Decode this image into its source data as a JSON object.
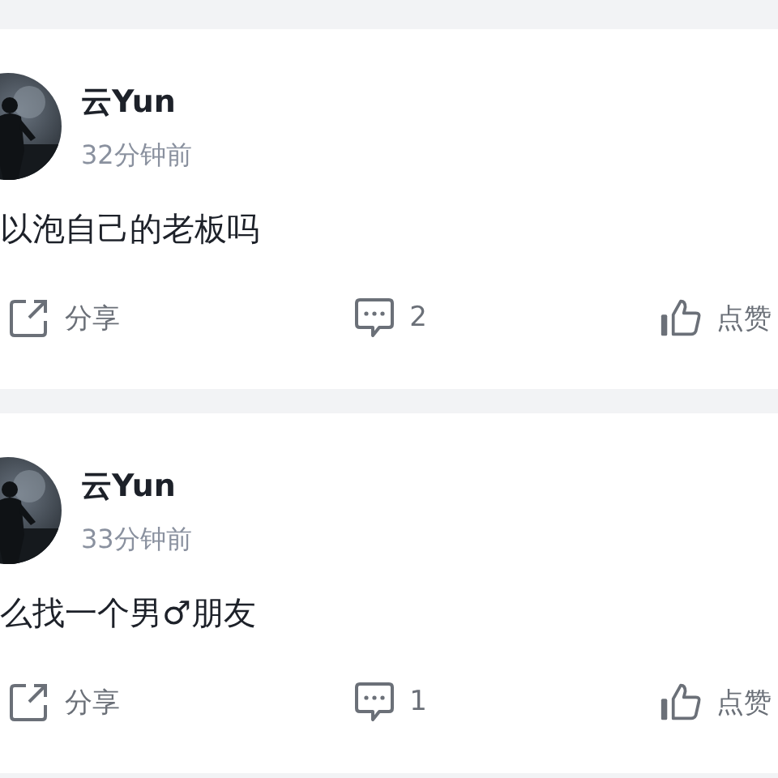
{
  "posts": [
    {
      "author": "云Yun",
      "time": "32分钟前",
      "content": "以泡自己的老板吗",
      "actions": {
        "share": "分享",
        "comments": "2",
        "like": "点赞"
      }
    },
    {
      "author": "云Yun",
      "time": "33分钟前",
      "content": "么找一个男♂朋友",
      "actions": {
        "share": "分享",
        "comments": "1",
        "like": "点赞"
      }
    }
  ]
}
